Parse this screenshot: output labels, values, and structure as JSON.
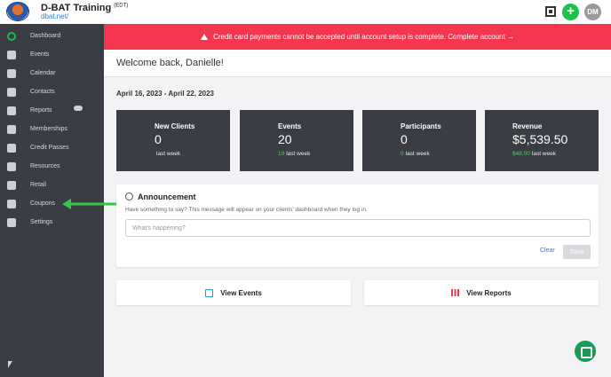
{
  "header": {
    "brand_name": "D-BAT Training",
    "timezone": "(EDT)",
    "brand_url": "dbat.net/",
    "avatar_initials": "DM",
    "add_symbol": "+"
  },
  "sidebar": {
    "items": [
      {
        "label": "Dashboard",
        "icon": "dashboard-icon"
      },
      {
        "label": "Events",
        "icon": "events-icon"
      },
      {
        "label": "Calendar",
        "icon": "calendar-icon"
      },
      {
        "label": "Contacts",
        "icon": "contacts-icon"
      },
      {
        "label": "Reports",
        "icon": "reports-icon"
      },
      {
        "label": "Memberships",
        "icon": "memberships-icon"
      },
      {
        "label": "Credit Passes",
        "icon": "credit-passes-icon"
      },
      {
        "label": "Resources",
        "icon": "resources-icon"
      },
      {
        "label": "Retail",
        "icon": "retail-icon"
      },
      {
        "label": "Coupons",
        "icon": "coupons-icon"
      },
      {
        "label": "Settings",
        "icon": "settings-icon"
      }
    ]
  },
  "banner": {
    "text": "Credit card payments cannot be accepted until account setup is complete. Complete account →"
  },
  "welcome": {
    "text": "Welcome back, Danielle!"
  },
  "date_range": "April 16, 2023 - April 22, 2023",
  "stats": [
    {
      "title": "New Clients",
      "value": "0",
      "change": "",
      "sub": "last week"
    },
    {
      "title": "Events",
      "value": "20",
      "change": "19",
      "sub": "last week"
    },
    {
      "title": "Participants",
      "value": "0",
      "change": "0",
      "sub": "last week"
    },
    {
      "title": "Revenue",
      "value": "$5,539.50",
      "change": "$48.00",
      "sub": "last week"
    }
  ],
  "announcement": {
    "title": "Announcement",
    "description": "Have something to say? This message will appear on your clients' dashboard when they log in.",
    "placeholder": "What's happening?",
    "clear_label": "Clear",
    "save_label": "Save"
  },
  "actions": {
    "view_events": "View Events",
    "view_reports": "View Reports"
  },
  "colors": {
    "sidebar": "#3b3d44",
    "banner": "#f5364f",
    "accent_green": "#1bc24b",
    "link_blue": "#2c7be5"
  }
}
